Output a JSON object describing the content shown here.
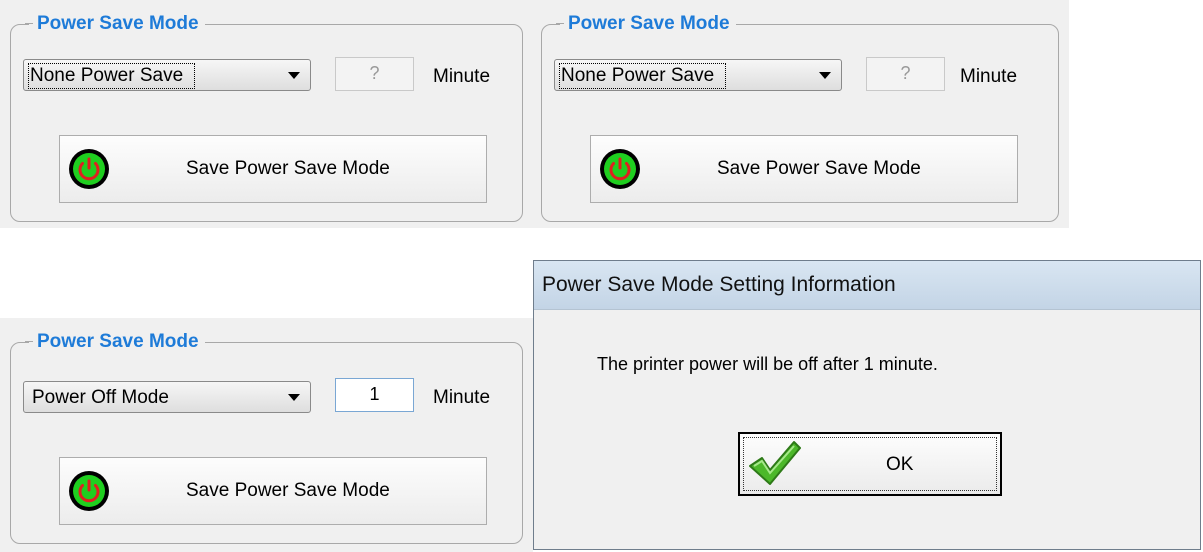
{
  "panels": [
    {
      "legend": "Power Save Mode",
      "mode_value": "None Power Save",
      "minute_value": "?",
      "minute_label": "Minute",
      "button_label": "Save Power Save Mode"
    },
    {
      "legend": "Power Save Mode",
      "mode_value": "None Power Save",
      "minute_value": "?",
      "minute_label": "Minute",
      "button_label": "Save Power Save Mode"
    },
    {
      "legend": "Power Save Mode",
      "mode_value": "Power Off Mode",
      "minute_value": "1",
      "minute_label": "Minute",
      "button_label": "Save Power Save Mode"
    }
  ],
  "dialog": {
    "title": "Power Save Mode Setting Information",
    "message": "The printer power will be off after 1 minute.",
    "ok_label": "OK"
  },
  "colors": {
    "legend": "#1e7bd8",
    "power_icon_green": "#1fcf1f",
    "power_icon_symbol": "#e02020",
    "check_green": "#4cb82a"
  },
  "icons": {
    "power": "power-icon",
    "check": "checkmark-icon"
  }
}
